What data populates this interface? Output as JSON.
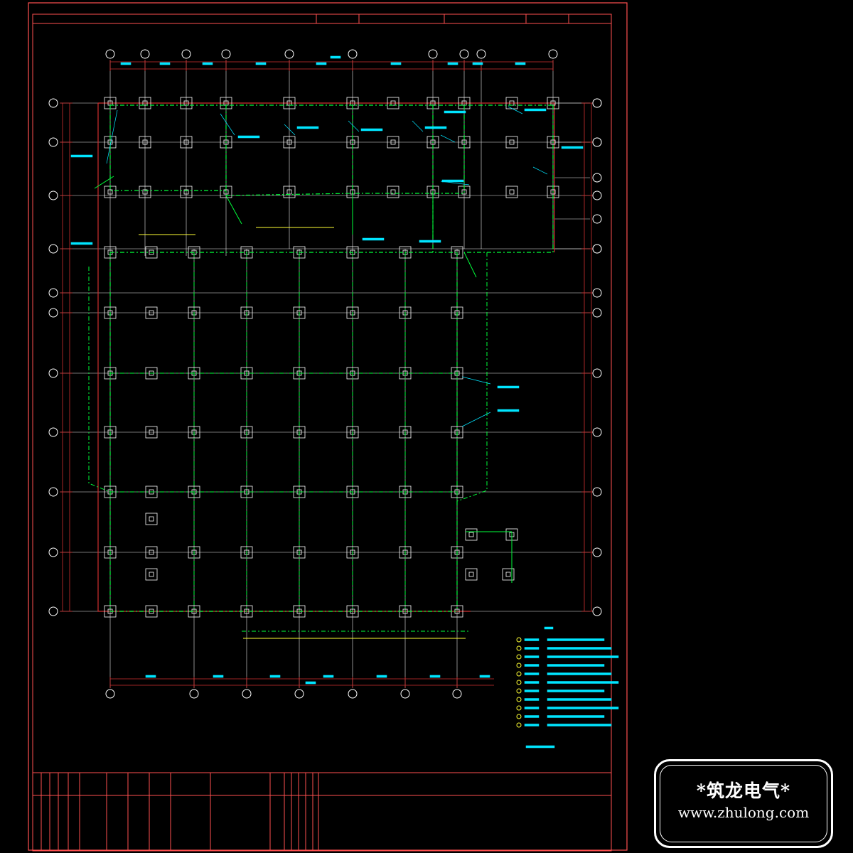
{
  "colors": {
    "frame": "#ff5050",
    "axis": "#e8e8e8",
    "grid": "#d03030",
    "cyan": "#00e5ff",
    "green": "#00ff3a",
    "yellow": "#ffff33",
    "white": "#ffffff",
    "bubble": "#ffffff"
  },
  "watermark": {
    "name": "*筑龙电气*",
    "url": "www.zhulong.com"
  }
}
